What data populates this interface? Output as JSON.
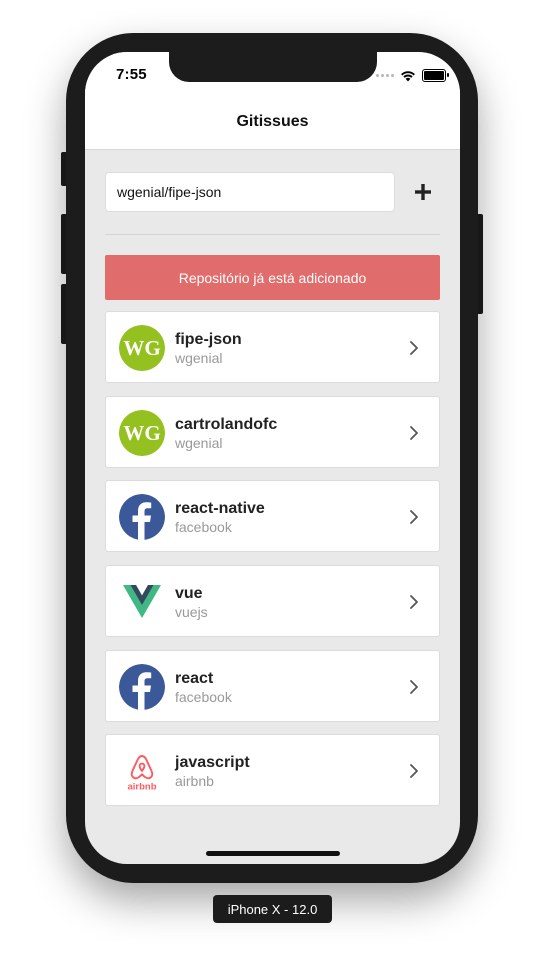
{
  "status_bar": {
    "time": "7:55"
  },
  "navbar": {
    "title": "Gitissues"
  },
  "form": {
    "input_value": "wgenial/fipe-json",
    "add_icon": "plus-icon"
  },
  "error_message": "Repositório já está adicionado",
  "colors": {
    "error_banner": "#e06c6c",
    "wgenial_green": "#94c11f",
    "facebook_blue": "#3b5998",
    "vue_green": "#41b883",
    "vue_dark": "#34495e",
    "airbnb_red": "#ff5a5f"
  },
  "repositories": [
    {
      "name": "fipe-json",
      "owner": "wgenial",
      "avatar": "wg-logo"
    },
    {
      "name": "cartrolandofc",
      "owner": "wgenial",
      "avatar": "wg-logo"
    },
    {
      "name": "react-native",
      "owner": "facebook",
      "avatar": "facebook-logo"
    },
    {
      "name": "vue",
      "owner": "vuejs",
      "avatar": "vue-logo"
    },
    {
      "name": "react",
      "owner": "facebook",
      "avatar": "facebook-logo"
    },
    {
      "name": "javascript",
      "owner": "airbnb",
      "avatar": "airbnb-logo",
      "avatar_text": "airbnb"
    }
  ],
  "device_label": "iPhone X - 12.0"
}
